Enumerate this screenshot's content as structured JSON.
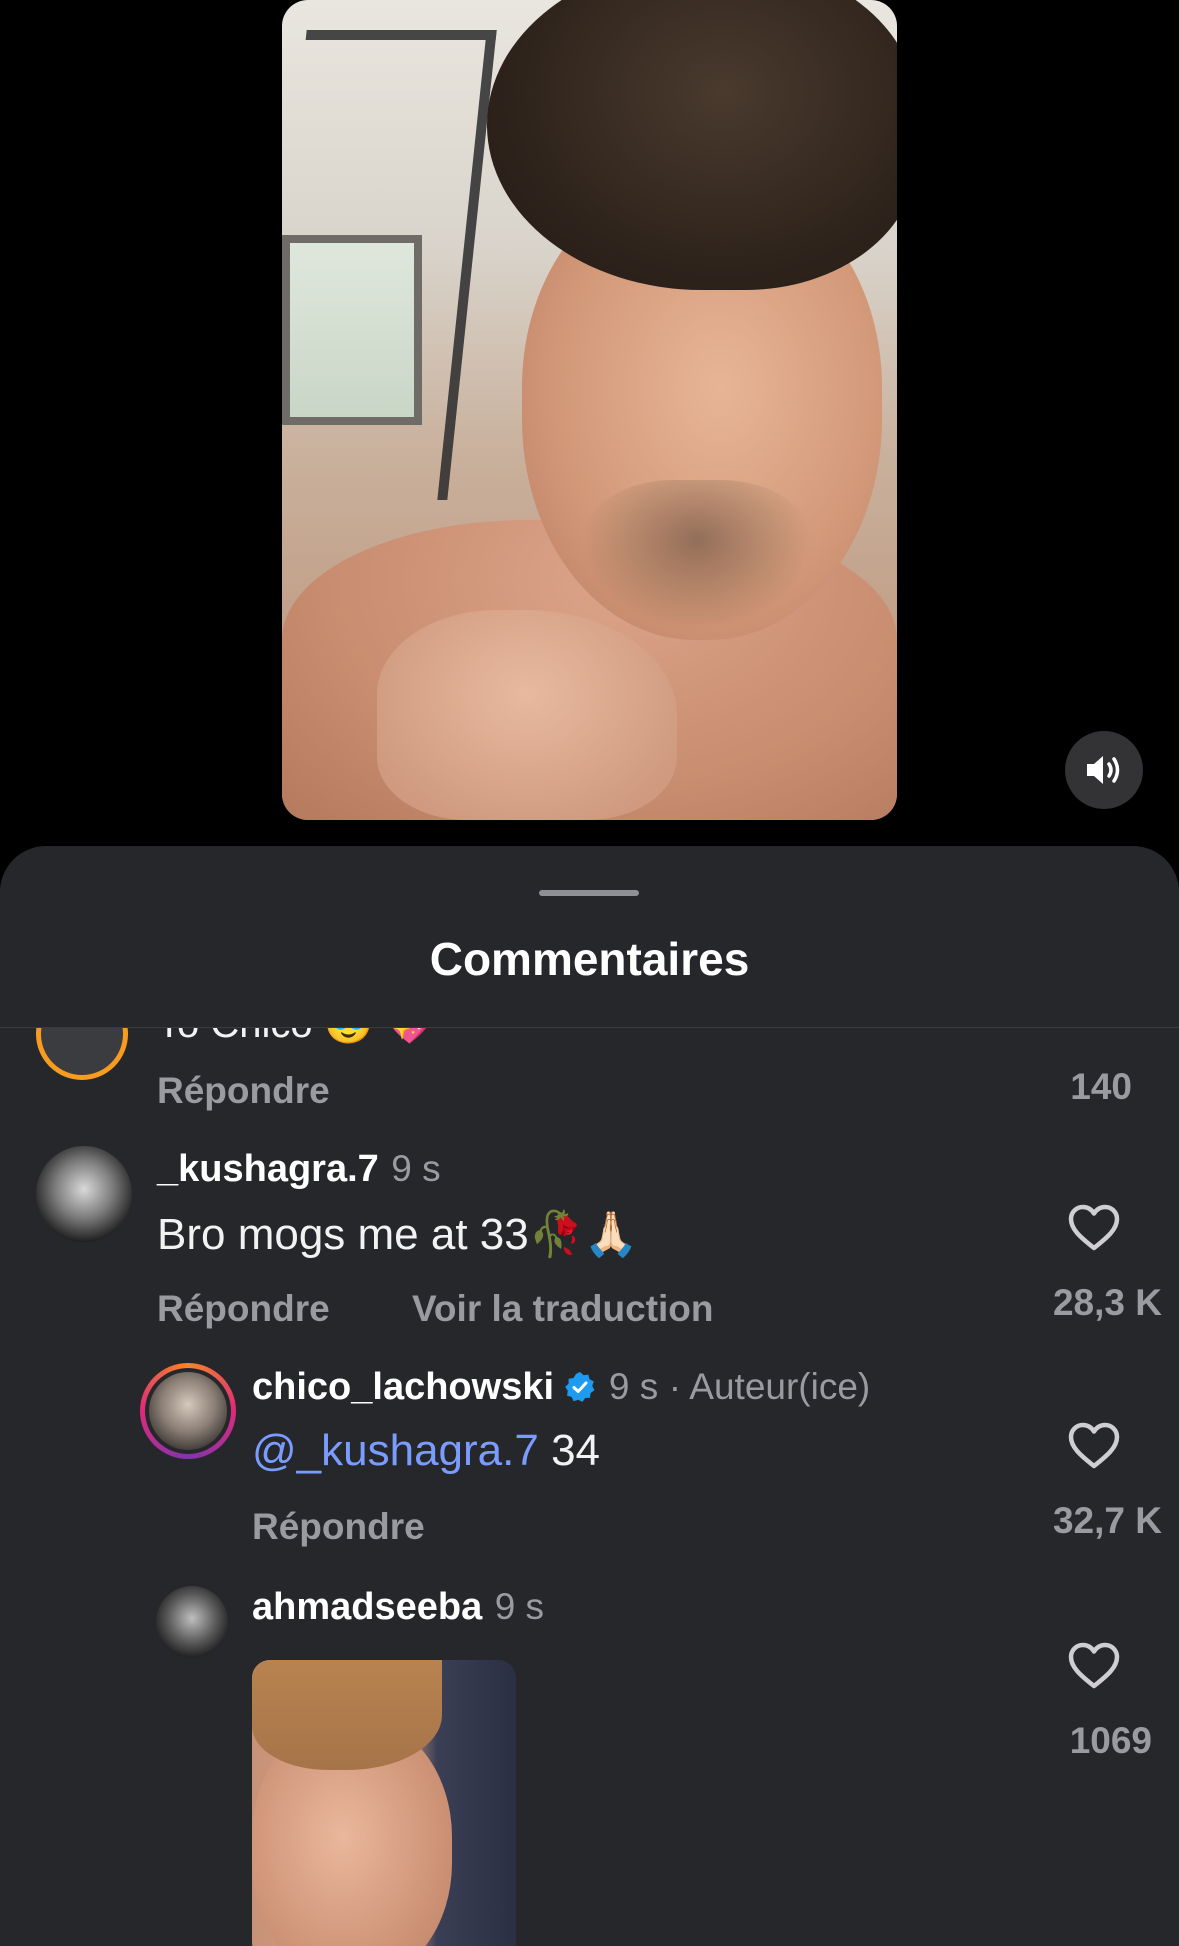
{
  "sheet": {
    "title": "Commentaires"
  },
  "previous_comment": {
    "partial_text": "To Chico 🥹 💖",
    "reply_label": "Répondre",
    "likes": "140"
  },
  "comments": [
    {
      "username": "_kushagra.7",
      "time": "9 s",
      "text": "Bro mogs me at 33🥀🙏🏻",
      "reply_label": "Répondre",
      "translate_label": "Voir la traduction",
      "likes": "28,3 K"
    },
    {
      "username": "chico_lachowski",
      "time": "9 s",
      "author_tag": "· Auteur(ice)",
      "mention": "@_kushagra.7",
      "text": " 34",
      "reply_label": "Répondre",
      "likes": "32,7 K"
    },
    {
      "username": "ahmadseeba",
      "time": "9 s",
      "likes": "1069"
    }
  ],
  "icons": {
    "mute": "speaker-icon",
    "like": "heart-icon",
    "verified": "verified-badge-icon"
  },
  "colors": {
    "sheet_bg": "#26272b",
    "mention": "#7b9cff",
    "secondary_text": "#9a9ba1",
    "verified": "#1d9bf0",
    "story_ring": "#f79c1f"
  }
}
